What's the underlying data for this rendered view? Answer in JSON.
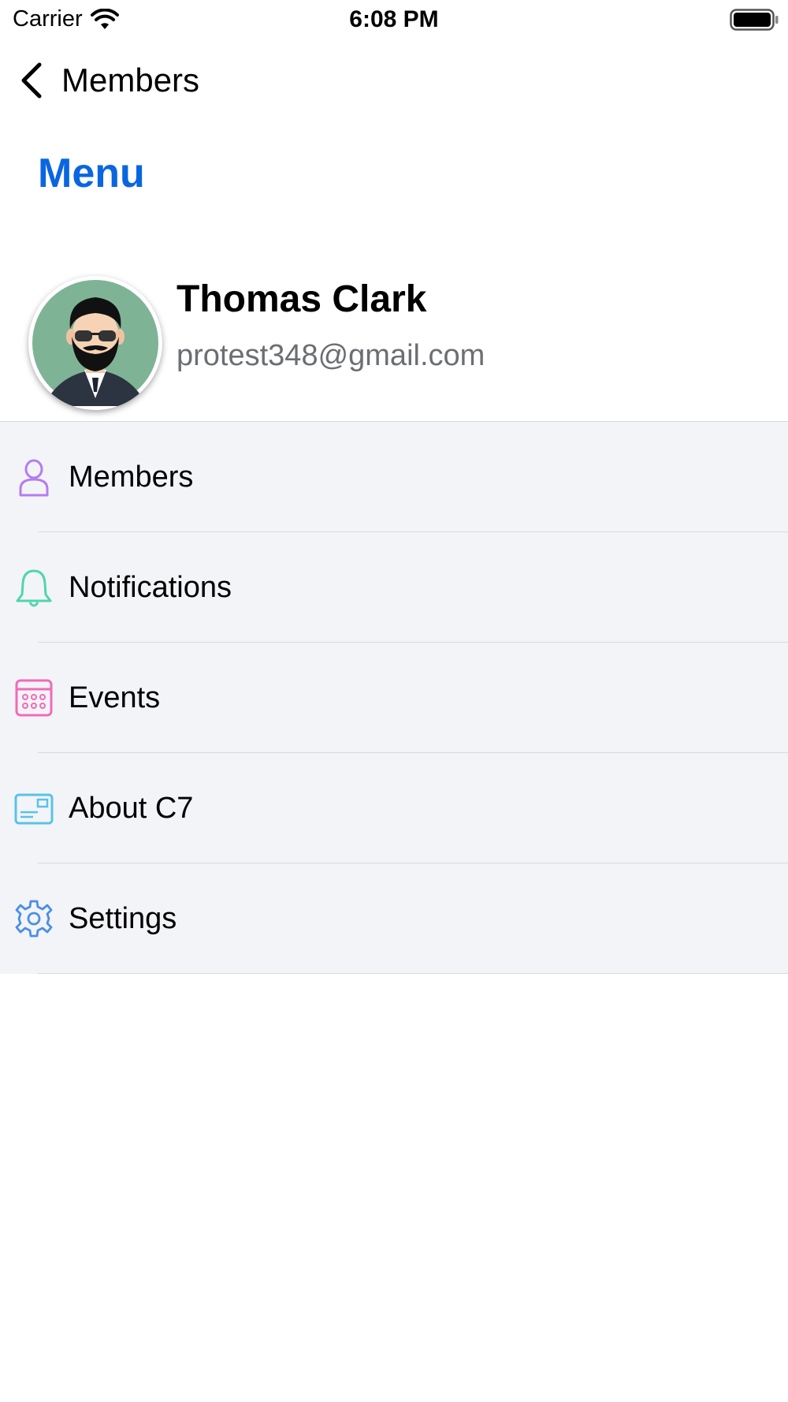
{
  "status_bar": {
    "carrier": "Carrier",
    "time": "6:08 PM"
  },
  "nav": {
    "back_label": "Members"
  },
  "page": {
    "title": "Menu"
  },
  "profile": {
    "name": "Thomas Clark",
    "email": "protest348@gmail.com"
  },
  "menu": {
    "items": [
      {
        "label": "Members",
        "icon": "person-icon",
        "color": "#b57cf0"
      },
      {
        "label": "Notifications",
        "icon": "bell-icon",
        "color": "#4fd6a8"
      },
      {
        "label": "Events",
        "icon": "calendar-icon",
        "color": "#f06bb8"
      },
      {
        "label": "About C7",
        "icon": "id-card-icon",
        "color": "#58c3e8"
      },
      {
        "label": "Settings",
        "icon": "gear-icon",
        "color": "#4a8fe6"
      }
    ]
  },
  "colors": {
    "accent": "#0a66e0",
    "list_background": "#f3f4f8",
    "avatar_background": "#7fb396"
  }
}
